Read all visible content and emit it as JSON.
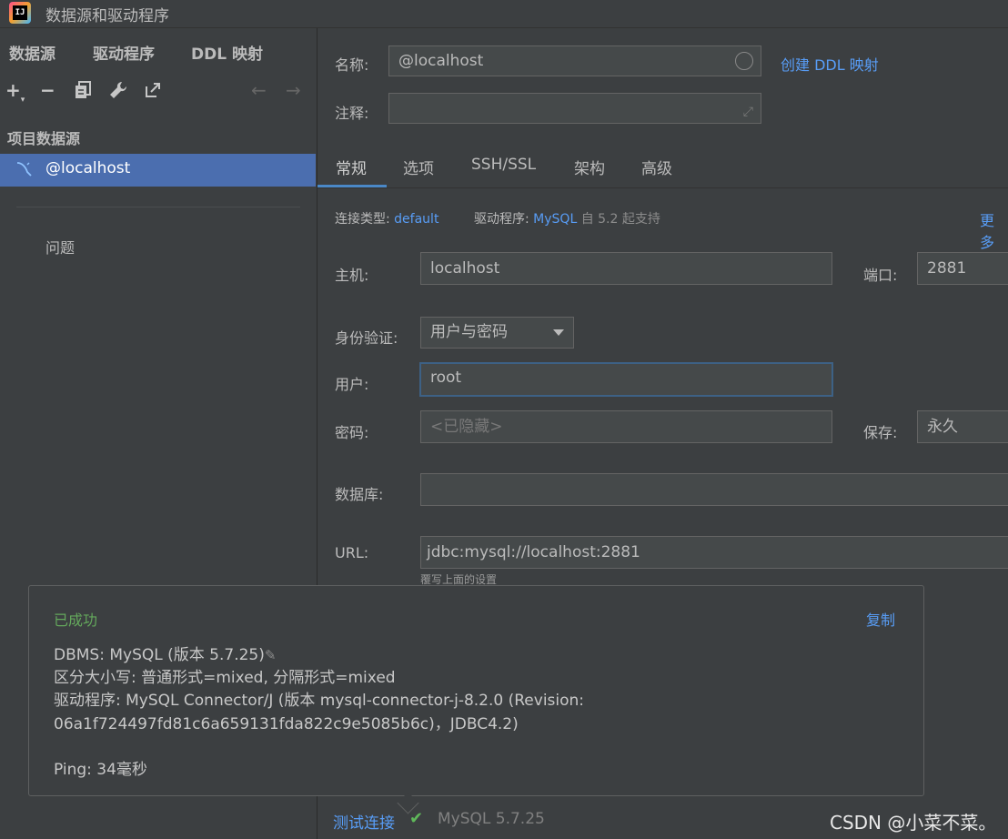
{
  "window": {
    "title": "数据源和驱动程序"
  },
  "left": {
    "tabs": [
      "数据源",
      "驱动程序",
      "DDL 映射"
    ],
    "section_title": "项目数据源",
    "datasource": "@localhost",
    "problems": "问题"
  },
  "form": {
    "name_label": "名称:",
    "name_value": "@localhost",
    "create_ddl": "创建 DDL 映射",
    "comment_label": "注释:",
    "comment_value": "",
    "tabs": [
      "常规",
      "选项",
      "SSH/SSL",
      "架构",
      "高级"
    ],
    "conn_type_label": "连接类型:",
    "conn_type_value": "default",
    "driver_label": "驱动程序:",
    "driver_value": "MySQL",
    "driver_support": "自 5.2 起支持",
    "more": "更多",
    "host_label": "主机:",
    "host_value": "localhost",
    "port_label": "端口:",
    "port_value": "2881",
    "auth_label": "身份验证:",
    "auth_value": "用户与密码",
    "user_label": "用户:",
    "user_value": "root",
    "password_label": "密码:",
    "password_placeholder": "<已隐藏>",
    "save_label": "保存:",
    "save_value": "永久",
    "database_label": "数据库:",
    "database_value": "",
    "url_label": "URL:",
    "url_value": "jdbc:mysql://localhost:2881",
    "url_hint": "覆写上面的设置"
  },
  "popup": {
    "status": "已成功",
    "copy": "复制",
    "dbms": "DBMS: MySQL (版本 5.7.25)",
    "case": "区分大小写: 普通形式=mixed, 分隔形式=mixed",
    "driver_line1": "驱动程序: MySQL Connector/J (版本 mysql-connector-j-8.2.0 (Revision:",
    "driver_line2": "06a1f724497fd81c6a659131fda822c9e5085b6c)，JDBC4.2)",
    "ping": "Ping: 34毫秒"
  },
  "bottom": {
    "test_connection": "测试连接",
    "result": "MySQL 5.7.25"
  },
  "watermark": "CSDN @小菜不菜。",
  "colors": {
    "accent": "#4b6eaf",
    "link": "#589df6",
    "success": "#64a85c"
  },
  "icons": [
    "add-icon",
    "remove-icon",
    "duplicate-icon",
    "wrench-icon",
    "jump-icon",
    "back-arrow-icon",
    "forward-arrow-icon",
    "mysql-icon",
    "check-icon",
    "pencil-icon",
    "expand-icon",
    "dropdown-arrow-icon"
  ]
}
